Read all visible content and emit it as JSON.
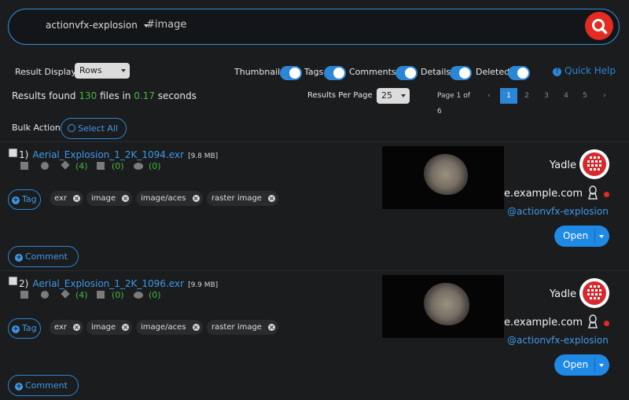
{
  "search": {
    "collection": "actionvfx-explosion",
    "query": "#image"
  },
  "controls": {
    "result_display_label": "Result Display:",
    "result_display_value": "Rows",
    "toggles": [
      {
        "label": "Thumbnail",
        "on": true
      },
      {
        "label": "Tags",
        "on": true
      },
      {
        "label": "Comments",
        "on": true
      },
      {
        "label": "Details",
        "on": true
      },
      {
        "label": "Deleted",
        "on": true
      }
    ],
    "quick_help": "Quick Help"
  },
  "summary": {
    "prefix": "Results found",
    "count": "130",
    "middle": "files in",
    "time": "0.17",
    "suffix": "seconds"
  },
  "per_page": {
    "label": "Results Per Page",
    "value": "25"
  },
  "pagination": {
    "page_label": "Page 1 of 6",
    "prev": "‹",
    "pages": [
      "1",
      "2",
      "3",
      "4",
      "5"
    ],
    "next": "›",
    "active": "1"
  },
  "bulk": {
    "label": "Bulk Action",
    "select_all": "Select All"
  },
  "results": [
    {
      "index": "1)",
      "name": "Aerial_Explosion_1_2K_1094.exr",
      "size": "[9.8 MB]",
      "tags_count": "(4)",
      "copies_count": "(0)",
      "comments_count": "(0)",
      "tag_button": "Tag",
      "tags": [
        "exr",
        "image",
        "image/aces",
        "raster image"
      ],
      "comment_button": "Comment",
      "owner": "Yadle",
      "domain": "e.example.com",
      "handle": "@actionvfx-explosion",
      "open": "Open"
    },
    {
      "index": "2)",
      "name": "Aerial_Explosion_1_2K_1096.exr",
      "size": "[9.9 MB]",
      "tags_count": "(4)",
      "copies_count": "(0)",
      "comments_count": "(0)",
      "tag_button": "Tag",
      "tags": [
        "exr",
        "image",
        "image/aces",
        "raster image"
      ],
      "comment_button": "Comment",
      "owner": "Yadle",
      "domain": "e.example.com",
      "handle": "@actionvfx-explosion",
      "open": "Open"
    }
  ],
  "colors": {
    "accent": "#2b86d6",
    "search_button": "#e32b22",
    "count_green": "#46b640",
    "background": "#1b1c1e"
  }
}
